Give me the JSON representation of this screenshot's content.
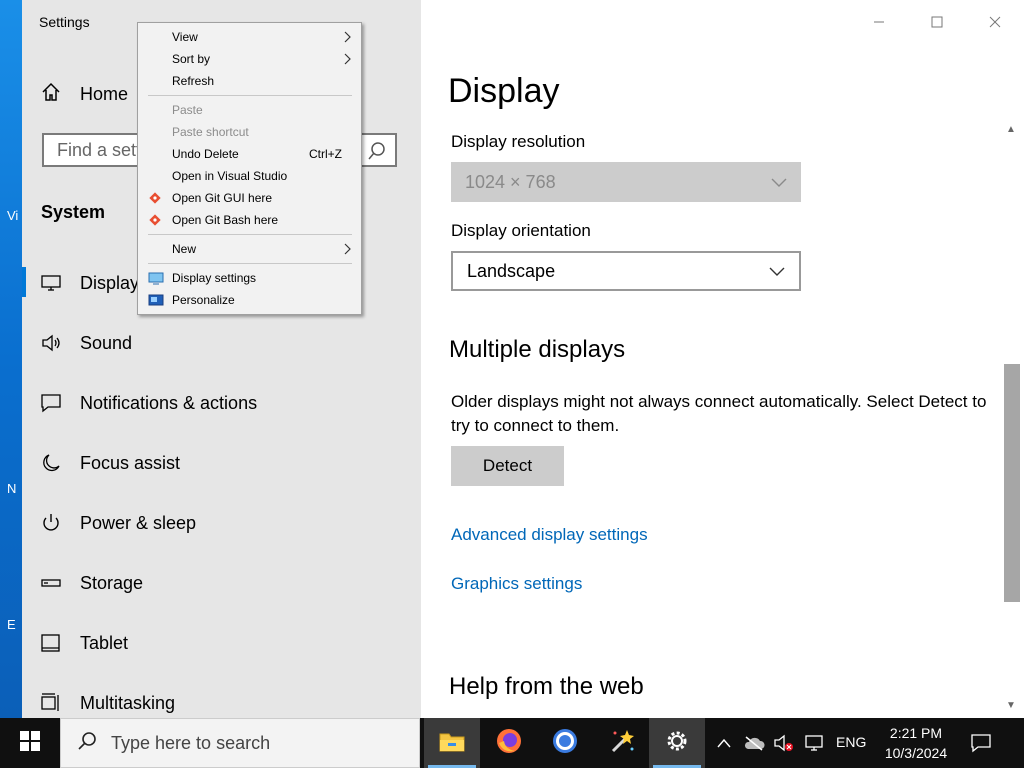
{
  "desktop": {
    "labels": [
      "Vi",
      "N",
      "E"
    ]
  },
  "window": {
    "app_title": "Settings",
    "controls": {
      "minimize": "minimize-icon",
      "maximize": "maximize-icon",
      "close": "close-icon"
    }
  },
  "sidebar": {
    "home_label": "Home",
    "search_placeholder": "Find a setting",
    "section_title": "System",
    "items": [
      {
        "label": "Display",
        "icon": "monitor-icon",
        "active": true
      },
      {
        "label": "Sound",
        "icon": "speaker-icon"
      },
      {
        "label": "Notifications & actions",
        "icon": "notification-icon"
      },
      {
        "label": "Focus assist",
        "icon": "moon-icon"
      },
      {
        "label": "Power & sleep",
        "icon": "power-icon"
      },
      {
        "label": "Storage",
        "icon": "storage-icon"
      },
      {
        "label": "Tablet",
        "icon": "tablet-icon"
      },
      {
        "label": "Multitasking",
        "icon": "multitasking-icon"
      }
    ]
  },
  "content": {
    "page_title": "Display",
    "resolution_label": "Display resolution",
    "resolution_value": "1024 × 768",
    "orientation_label": "Display orientation",
    "orientation_value": "Landscape",
    "multiple_heading": "Multiple displays",
    "multiple_text": "Older displays might not always connect automatically. Select Detect to try to connect to them.",
    "detect_button": "Detect",
    "advanced_link": "Advanced display settings",
    "graphics_link": "Graphics settings",
    "help_heading": "Help from the web"
  },
  "context_menu": {
    "view": "View",
    "sort_by": "Sort by",
    "refresh": "Refresh",
    "paste": "Paste",
    "paste_shortcut": "Paste shortcut",
    "undo_delete": "Undo Delete",
    "undo_shortcut": "Ctrl+Z",
    "open_vs": "Open in Visual Studio",
    "open_git_gui": "Open Git GUI here",
    "open_git_bash": "Open Git Bash here",
    "new": "New",
    "display_settings": "Display settings",
    "personalize": "Personalize"
  },
  "taskbar": {
    "search_placeholder": "Type here to search",
    "apps": [
      "file-explorer-icon",
      "firefox-icon",
      "chrome-icon",
      "magic-wand-icon",
      "settings-gear-icon"
    ],
    "language": "ENG",
    "time": "2:21 PM",
    "date": "10/3/2024"
  },
  "colors": {
    "accent": "#0078d7",
    "link": "#0067b8",
    "sidebar_bg": "#e6e6e6",
    "taskbar_bg": "#101010"
  }
}
